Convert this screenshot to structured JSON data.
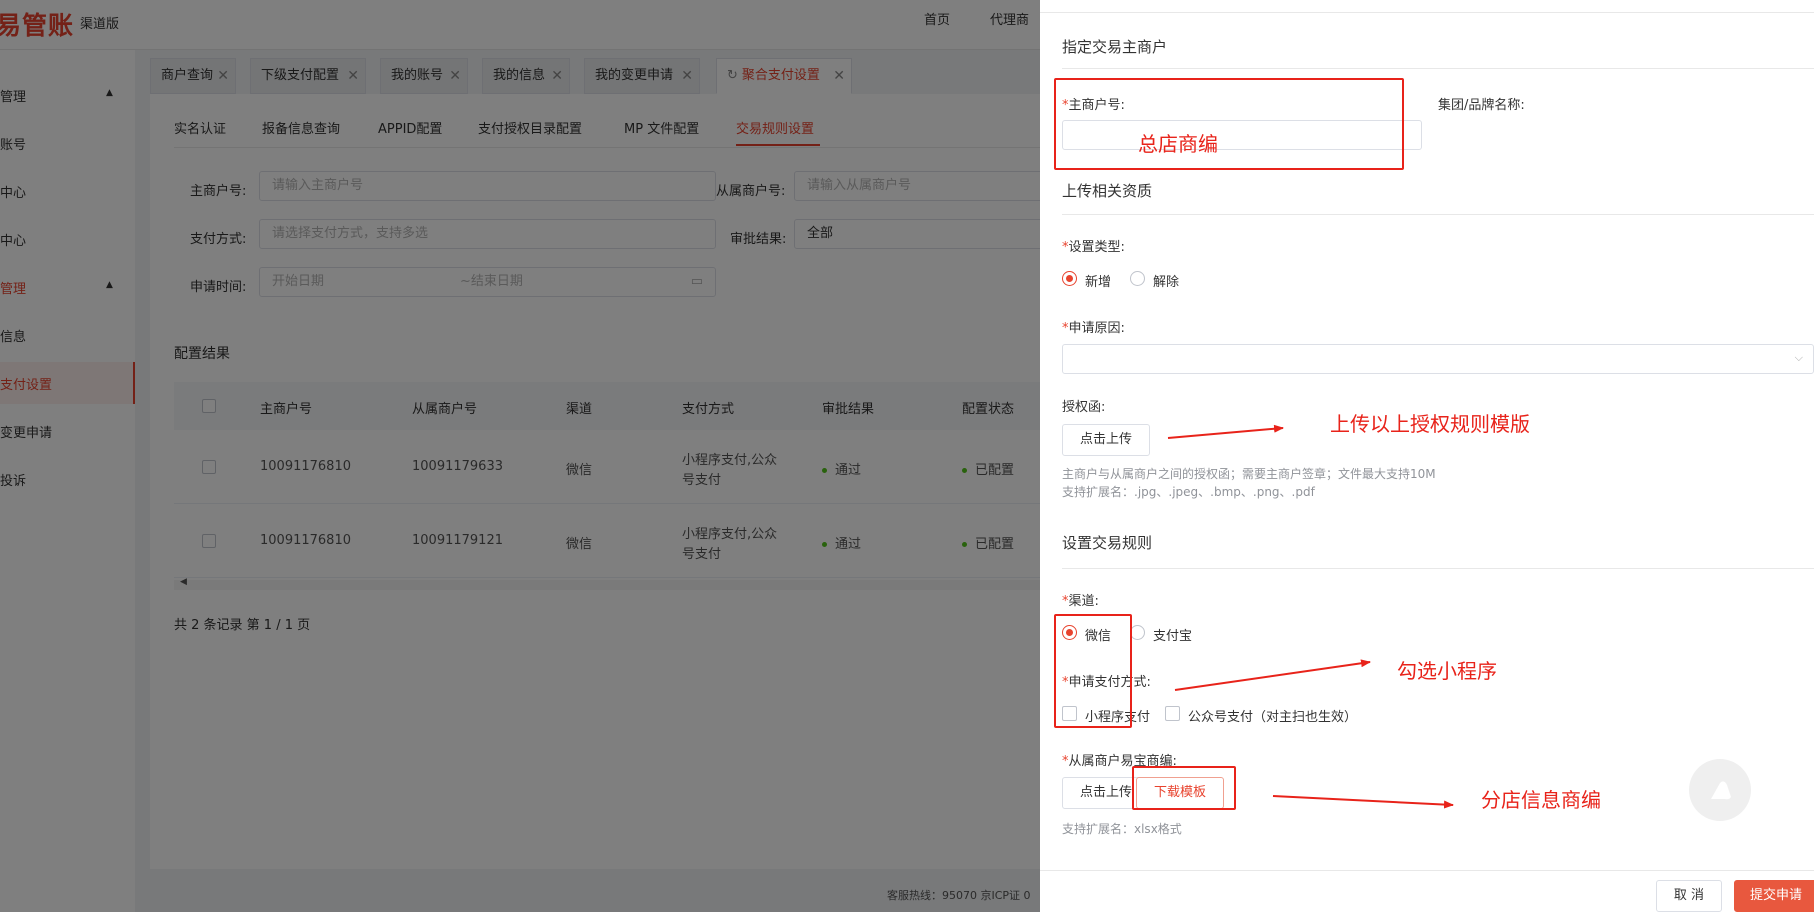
{
  "header": {
    "logo": "易管账",
    "logo_sub": "渠道版",
    "nav": [
      "首页",
      "代理商"
    ]
  },
  "sidebar": {
    "items": [
      {
        "label": "管理",
        "group": true
      },
      {
        "label": "账号"
      },
      {
        "label": "中心"
      },
      {
        "label": "中心"
      },
      {
        "label": "管理",
        "group": true
      },
      {
        "label": "信息"
      },
      {
        "label": "支付设置",
        "active": true
      },
      {
        "label": "变更申请"
      },
      {
        "label": "投诉"
      }
    ]
  },
  "tabs": [
    "商户查询",
    "下级支付配置",
    "我的账号",
    "我的信息",
    "我的变更申请",
    "聚合支付设置"
  ],
  "subtabs": [
    "实名认证",
    "报备信息查询",
    "APPID配置",
    "支付授权目录配置",
    "MP 文件配置",
    "交易规则设置"
  ],
  "filters": {
    "main_label": "主商户号:",
    "main_placeholder": "请输入主商户号",
    "sub_label": "从属商户号:",
    "sub_placeholder": "请输入从属商户号",
    "pay_label": "支付方式:",
    "pay_placeholder": "请选择支付方式，支持多选",
    "approve_label": "审批结果:",
    "approve_value": "全部",
    "date_label": "申请时间:",
    "date_start": "开始日期",
    "date_sep": "~",
    "date_end": "结束日期"
  },
  "results": {
    "title": "配置结果",
    "columns": [
      "主商户号",
      "从属商户号",
      "渠道",
      "支付方式",
      "审批结果",
      "配置状态"
    ],
    "rows": [
      {
        "main": "10091176810",
        "sub": "10091179633",
        "channel": "微信",
        "pay1": "小程序支付,公众",
        "pay2": "号支付",
        "result": "通过",
        "status": "已配置"
      },
      {
        "main": "10091176810",
        "sub": "10091179121",
        "channel": "微信",
        "pay1": "小程序支付,公众",
        "pay2": "号支付",
        "result": "通过",
        "status": "已配置"
      }
    ],
    "pager": "共 2 条记录 第 1 / 1 页"
  },
  "footer": "客服热线：95070 京ICP证 0",
  "drawer": {
    "title": "指定交易主商户",
    "main_label": "主商户号:",
    "brand_label": "集团/品牌名称:",
    "upload_section": "上传相关资质",
    "type_label": "设置类型:",
    "type_options": [
      "新增",
      "解除"
    ],
    "reason_label": "申请原因:",
    "auth_label": "授权函:",
    "upload_btn": "点击上传",
    "auth_hint1": "主商户与从属商户之间的授权函；需要主商户签章；文件最大支持10M",
    "auth_hint2": "支持扩展名：.jpg、.jpeg、.bmp、.png、.pdf",
    "rules_section": "设置交易规则",
    "channel_label": "渠道:",
    "channel_options": [
      "微信",
      "支付宝"
    ],
    "pay_label": "申请支付方式:",
    "pay_options": [
      "小程序支付",
      "公众号支付（对主扫也生效）"
    ],
    "sub_label": "从属商户易宝商编:",
    "sub_upload_btn": "点击上传",
    "download_btn": "下载模板",
    "sub_hint": "支持扩展名：xlsx格式",
    "cancel_btn": "取 消",
    "submit_btn": "提交申请"
  },
  "annotations": {
    "main_store": "总店商编",
    "upload_tip": "上传以上授权规则模版",
    "check_tip": "勾选小程序",
    "branch_tip": "分店信息商编"
  }
}
